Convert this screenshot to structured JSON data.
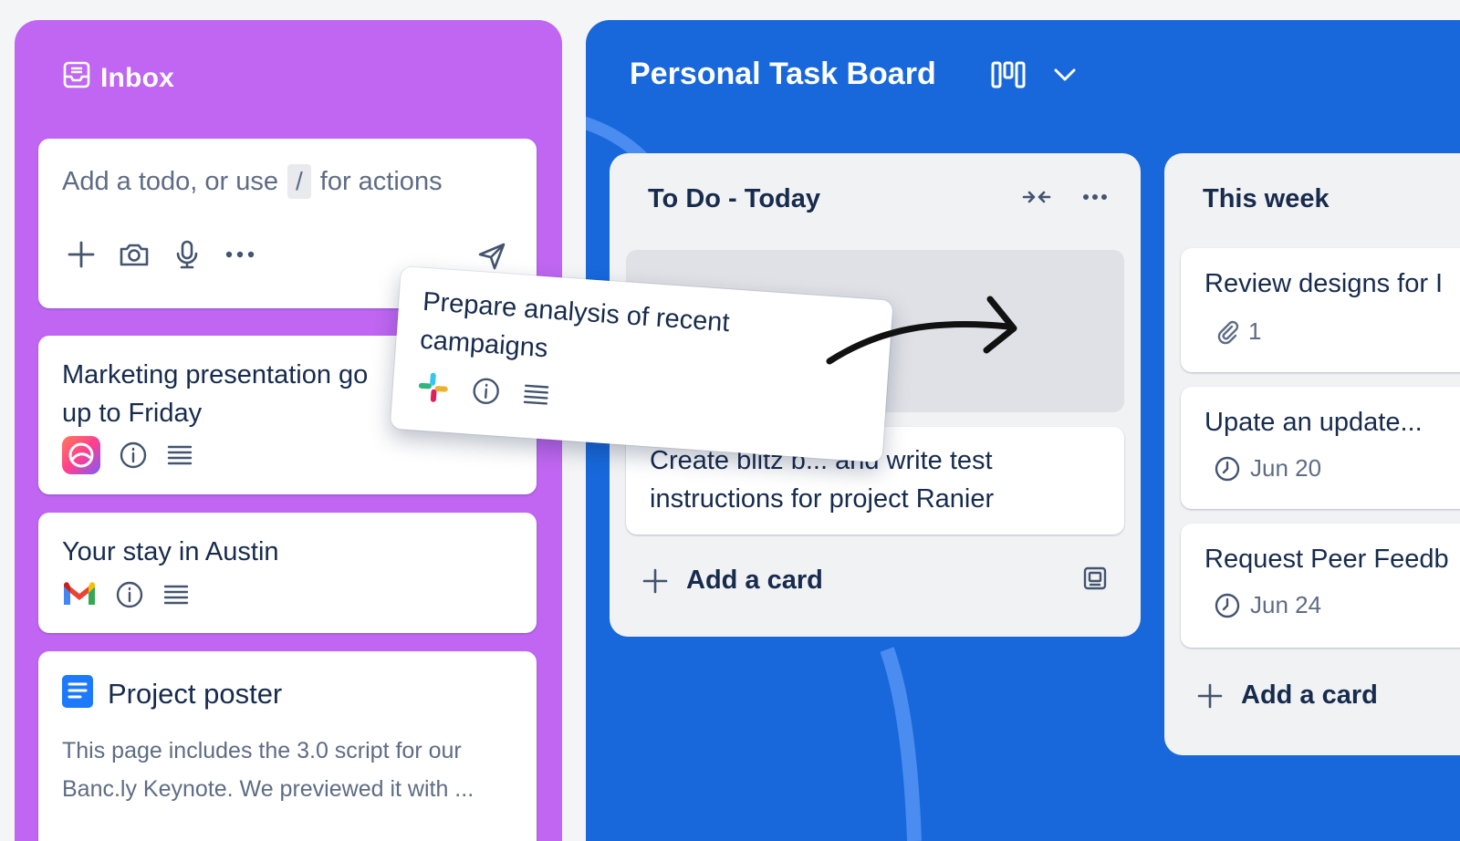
{
  "inbox": {
    "title": "Inbox",
    "composer": {
      "placeholder_prefix": "Add a todo, or use",
      "slash": "/",
      "placeholder_suffix": "for actions"
    },
    "cards": [
      {
        "title": "Marketing presentation go\nup to Friday",
        "source_icon": "app-icon"
      },
      {
        "title": "Your stay in Austin",
        "source_icon": "gmail-icon"
      },
      {
        "title": "Project poster",
        "body": "This page includes the 3.0 script for our Banc.ly Keynote. We previewed it with ...",
        "source_icon": "doc-icon"
      }
    ]
  },
  "board": {
    "title": "Personal Task Board",
    "lists": [
      {
        "title": "To Do - Today",
        "cards": [
          {
            "title": "Create blitz b... and write test\ninstructions for project Ranier"
          }
        ],
        "add_label": "Add a card"
      },
      {
        "title": "This week",
        "cards": [
          {
            "title": "Review designs for I",
            "attachments": "1"
          },
          {
            "title": "Upate an update...",
            "due": "Jun 20"
          },
          {
            "title": "Request Peer Feedb",
            "due": "Jun 24"
          }
        ],
        "add_label": "Add a card"
      }
    ]
  },
  "drag_card": {
    "title": "Prepare analysis of recent\ncampaigns",
    "source_icon": "slack-icon"
  },
  "colors": {
    "inbox_bg": "#c066f2",
    "board_bg": "#1868db",
    "list_bg": "#f1f2f4"
  }
}
